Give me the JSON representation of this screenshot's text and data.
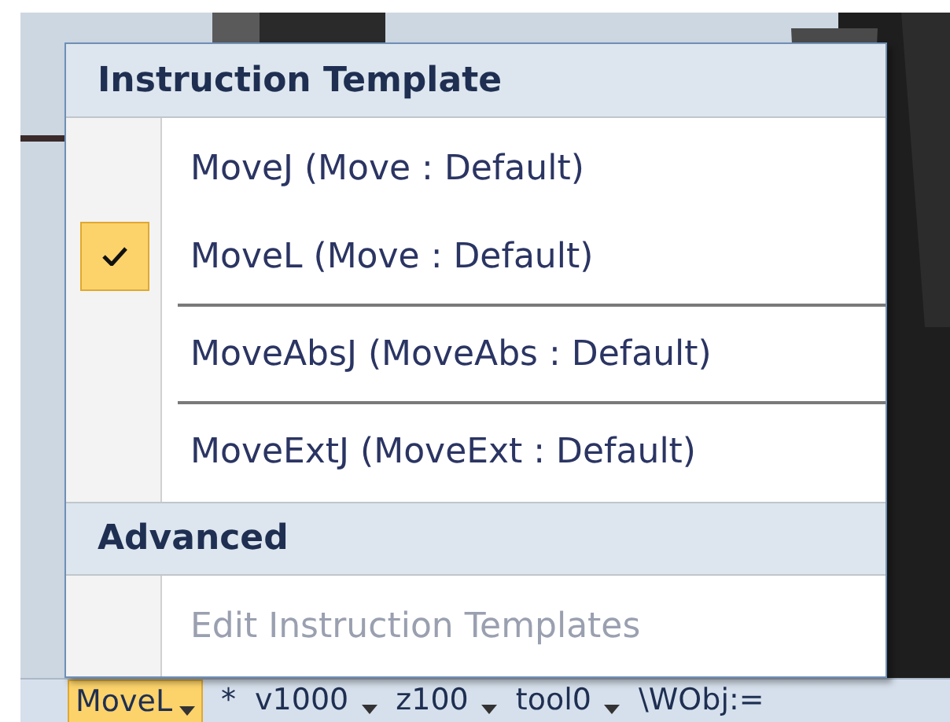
{
  "menu": {
    "sections": [
      {
        "title": "Instruction Template",
        "items": [
          {
            "label": "MoveJ (Move : Default)",
            "checked": false,
            "disabled": false,
            "divider_after": false
          },
          {
            "label": "MoveL (Move : Default)",
            "checked": true,
            "disabled": false,
            "divider_after": true
          },
          {
            "label": "MoveAbsJ (MoveAbs : Default)",
            "checked": false,
            "disabled": false,
            "divider_after": true
          },
          {
            "label": "MoveExtJ (MoveExt : Default)",
            "checked": false,
            "disabled": false,
            "divider_after": false
          }
        ]
      },
      {
        "title": "Advanced",
        "items": [
          {
            "label": "Edit Instruction Templates",
            "checked": false,
            "disabled": true,
            "divider_after": false
          }
        ]
      }
    ]
  },
  "toolbar": {
    "instruction": "MoveL",
    "args": [
      {
        "label": "*",
        "dropdown": false
      },
      {
        "label": "v1000",
        "dropdown": true
      },
      {
        "label": "z100",
        "dropdown": true
      },
      {
        "label": "tool0",
        "dropdown": true
      },
      {
        "label": "\\WObj:=",
        "dropdown": false
      }
    ]
  }
}
